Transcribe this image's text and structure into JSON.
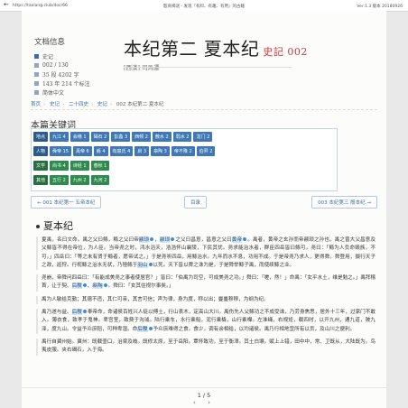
{
  "topbar": {
    "back_icon": "←",
    "url": "https://taolang.club/doc/66",
    "title": "殷商揭谜 - 发现『有料、有趣、有用』的古籍",
    "version": "Ver:1.3 版本 20180926"
  },
  "doc_info": {
    "label": "文档信息",
    "rows": [
      "史记",
      "002 / 130",
      "35 段 4202 字",
      "143 年 214 个标注",
      "简体中文"
    ]
  },
  "header": {
    "title": "本纪第二 夏本纪",
    "sub": "史記 002",
    "author": "[西漢] 司馬遷"
  },
  "breadcrumb": [
    "首页",
    "史记",
    "二十四史",
    "史记",
    "002 本纪第二 夏本纪"
  ],
  "keywords": {
    "title": "本篇关键词",
    "row1": [
      "地点",
      "九江 4",
      "会稽 1",
      "碣石 2",
      "彭蠡 3",
      "西倾 2",
      "敷水 2",
      "弱水 2",
      "龙门 2"
    ],
    "row2": [
      "人物",
      "舜帝 15",
      "禹帝 6",
      "鲧 4",
      "有扈氏 4",
      "启 3",
      "皋陶 3",
      "帝不降 2",
      "伯羿 2"
    ],
    "row3": [
      "文学",
      "尚书 4",
      "诗经 1",
      "春秋 1"
    ],
    "row4": [
      "其他",
      "五行 2",
      "九州 2",
      "九河 2"
    ]
  },
  "nav": {
    "prev": "← 001 本纪第一 五帝本纪",
    "mid": "目录",
    "next": "003 本纪第三 殷本纪 →"
  },
  "section": {
    "title": "夏本纪"
  },
  "paragraphs": [
    {
      "parts": [
        {
          "t": "夏禹，名曰文命。禹之父曰鲧，鲧之父曰帝"
        },
        {
          "t": "颛顼",
          "hl": true
        },
        {
          "t": "，"
        },
        {
          "t": "颛顼",
          "hl": true
        },
        {
          "t": "之父曰昌意，昌意之父曰"
        },
        {
          "t": "黄帝",
          "hl": true
        },
        {
          "t": "。禹者，黄帝之玄孙而帝颛顼之孙也。禹之曾大父昌意及父鲧皆不得在帝位，为人臣。当帝尧之时，鸿水滔天，浩浩怀山襄陵，下民其忧。尧求能治水者，群臣四岳皆曰鲧可。尧曰：「鲧为人负命毁族，不可。」四岳曰：「等之未有贤于鲧者，愿帝试之。」于是尧听四岳，用鲧治水。九年而水不息，功用不成。于是帝尧乃求人，更得舜。舜登用，摄行天子之政，巡狩。行视鲧之治水无状，乃殛鲧于"
        },
        {
          "t": "羽山",
          "hl": true
        },
        {
          "t": "以死。天下皆以舜之诛为是。于是舜举鲧子禹，而使续鲧之业。"
        }
      ]
    },
    {
      "parts": [
        {
          "t": "尧崩，帝舜问四岳曰：「有能成美尧之事者使居官？」皆曰：「伯禹为司空，可成美尧之功。」舜曰：「嗟，然！」命禹：「女平水土，维是勉之。」禹拜稽首，让于契、"
        },
        {
          "t": "后稷",
          "hl": true
        },
        {
          "t": "、"
        },
        {
          "t": "皋陶",
          "hl": true
        },
        {
          "t": "。舜曰：「女其往视尔事矣。」"
        }
      ]
    },
    {
      "parts": [
        {
          "t": "禹为人敏给克勤；其德不违，其仁可亲，其言可信；声为律，身为度，称以出；亹亹穆穆，为纲为纪。"
        }
      ]
    },
    {
      "parts": [
        {
          "t": "禹乃遂与益、"
        },
        {
          "t": "后稷",
          "hl": true
        },
        {
          "t": "奉帝命，命诸侯百姓兴人徒以傅土，行山表木，定高山大川。禹伤先人父鲧功之不成受诛，乃劳身焦思，居外十三年，过家门不敢入。薄衣食，致孝于鬼神。卑宫室，致费于沟淢。陆行乘车，水行乘船，泥行乘橇，山行乘檋。左准绳，右规矩，载四时，以开九州，通九道，陂九泽，度九山。令益予众庶稻，可种卑湿。命"
        },
        {
          "t": "后稷",
          "hl": true
        },
        {
          "t": "予众庶难得之食。食少，调有余相给，以均诸侯。禹乃行相地宜所有以贡，及山川之便利。"
        }
      ]
    },
    {
      "parts": [
        {
          "t": "禹行自冀州始。冀州：既载壶口，治梁及岐。既修太原，至于岳阳。覃怀致功，至于衡漳。其土白壤。赋上上错，田中中，常、卫既从，大陆既为。鸟夷皮服。夹右碣石，入于海。"
        }
      ]
    }
  ],
  "pager": {
    "page": "1 / 5",
    "prev_icon": "‹",
    "next_icon": "›"
  }
}
